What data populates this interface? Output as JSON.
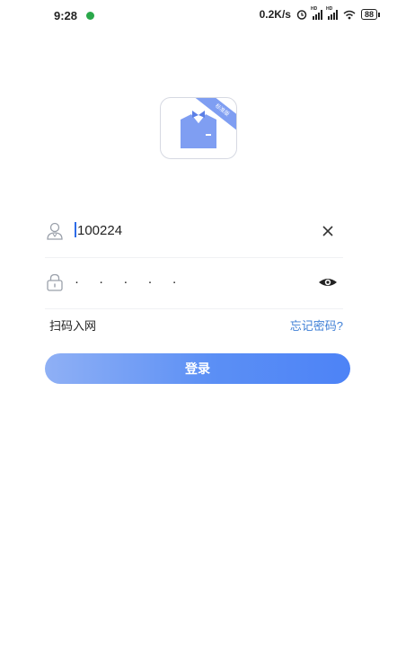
{
  "status_bar": {
    "time": "9:28",
    "network_speed": "0.2K/s",
    "sim1_label": "HD",
    "sim2_label": "HD",
    "battery": "88",
    "icons": [
      "app-notification-icon",
      "alarm-icon",
      "signal-icon",
      "signal-icon",
      "wifi-icon",
      "battery-icon"
    ]
  },
  "logo": {
    "ribbon_text": "标准版",
    "accent_color": "#7f9ef2"
  },
  "form": {
    "username_value": "100224",
    "password_value": "· · · · ·",
    "username_icon": "user-icon",
    "password_icon": "lock-icon",
    "clear_icon": "close-icon",
    "show_password_icon": "eye-icon"
  },
  "links": {
    "scan_label": "扫码入网",
    "forgot_label": "忘记密码?"
  },
  "login_button": {
    "label": "登录",
    "color_start": "#8fb0f5",
    "color_end": "#4d83f6"
  }
}
